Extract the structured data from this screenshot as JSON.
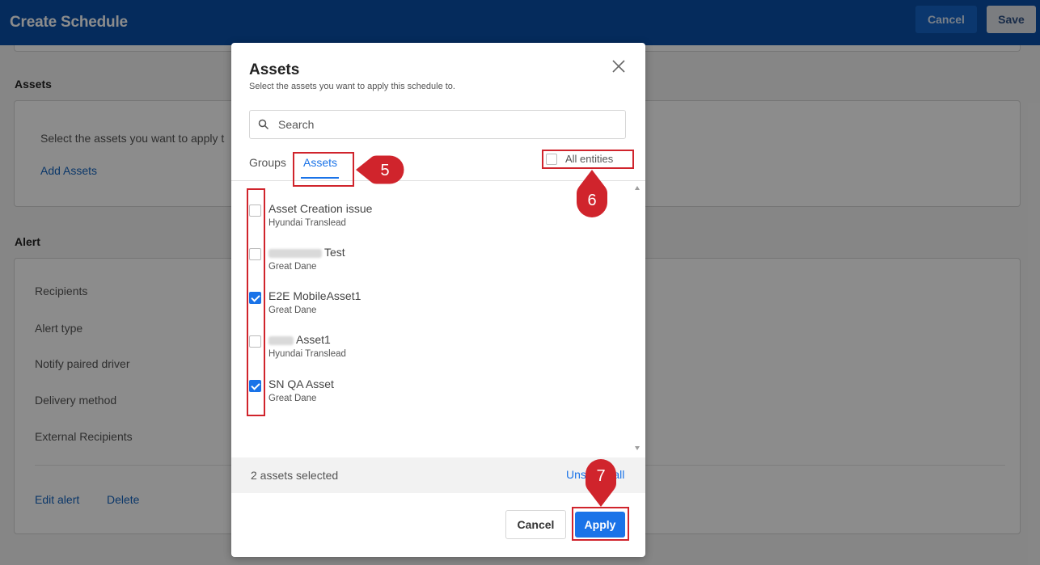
{
  "page": {
    "title": "Create Schedule",
    "cancel_label": "Cancel",
    "save_label": "Save"
  },
  "assets_section": {
    "heading": "Assets",
    "description": "Select the assets you want to apply t",
    "add_link": "Add Assets"
  },
  "alert_section": {
    "heading": "Alert",
    "fields": [
      "Recipients",
      "Alert type",
      "Notify paired driver",
      "Delivery method",
      "External Recipients"
    ],
    "edit_label": "Edit alert",
    "delete_label": "Delete"
  },
  "modal": {
    "title": "Assets",
    "subtitle": "Select the assets you want to apply this schedule to.",
    "search_placeholder": "Search",
    "tabs": [
      {
        "label": "Groups",
        "active": false
      },
      {
        "label": "Assets",
        "active": true
      }
    ],
    "all_entities_label": "All entities",
    "items": [
      {
        "name": "Asset Creation issue",
        "group": "Hyundai Translead",
        "checked": false
      },
      {
        "name": "Test",
        "group": "Great Dane",
        "checked": false
      },
      {
        "name": "E2E MobileAsset1",
        "group": "Great Dane",
        "checked": true
      },
      {
        "name": "Asset1",
        "group": "Hyundai Translead",
        "checked": false
      },
      {
        "name": "SN QA Asset",
        "group": "Great Dane",
        "checked": true
      }
    ],
    "selected_count": "2 assets selected",
    "unselect_all_label": "Unselect all",
    "cancel_label": "Cancel",
    "apply_label": "Apply"
  },
  "annotations": {
    "callout_5": "5",
    "callout_6": "6",
    "callout_7": "7",
    "color": "#d0242c"
  },
  "colors": {
    "header": "#0a4fa8",
    "accent": "#1a73e8"
  }
}
